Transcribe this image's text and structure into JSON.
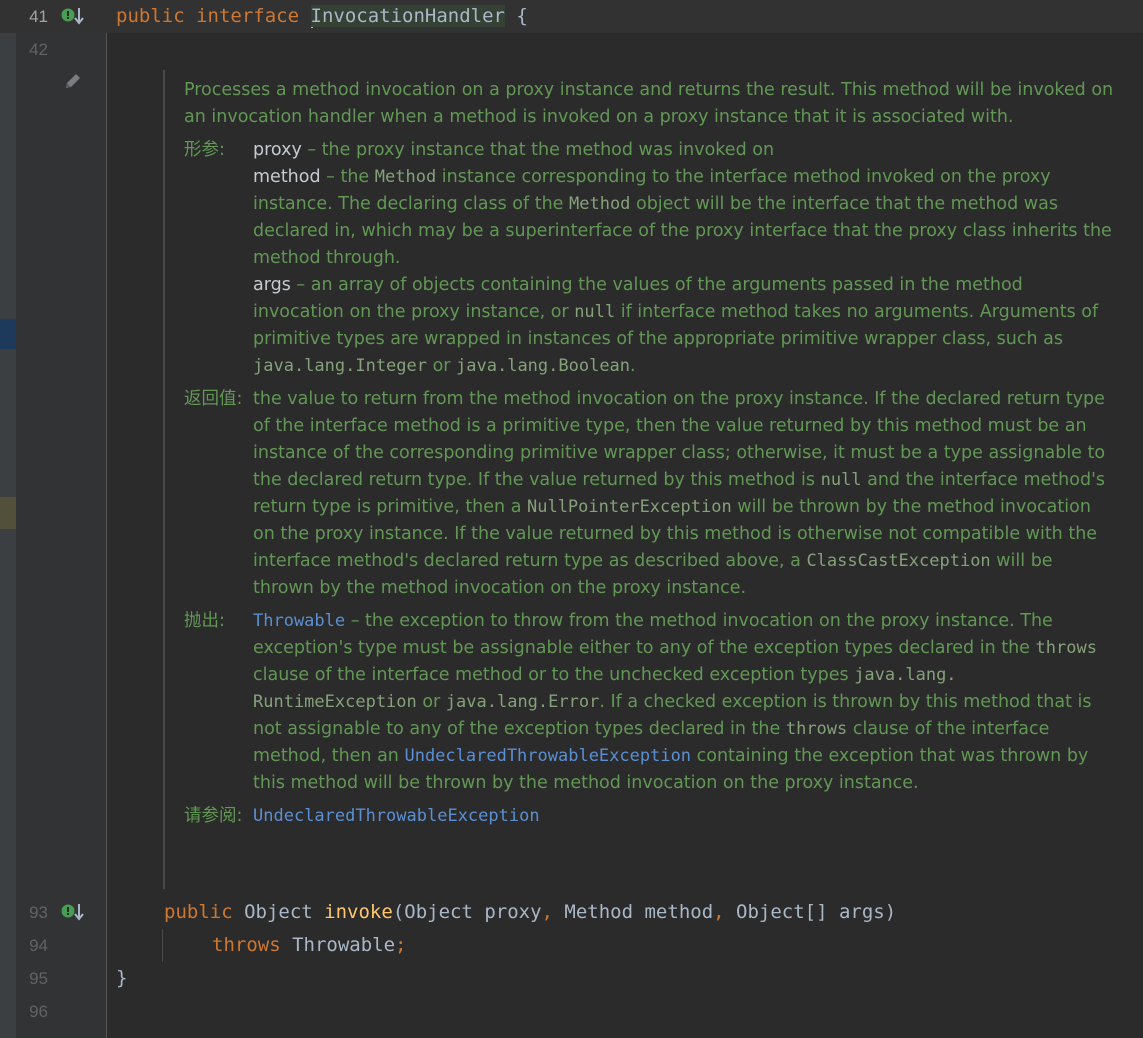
{
  "gutter": {
    "lines": [
      "41",
      "42",
      "93",
      "94",
      "95",
      "96"
    ]
  },
  "code": {
    "line41": {
      "kw1": "public",
      "kw2": "interface",
      "name": "InvocationHandler",
      "brace": "{"
    },
    "line93": {
      "kw": "public",
      "rest1": "Object ",
      "method": "invoke",
      "p1": "(Object proxy",
      "c1": ",",
      "p2": " Method method",
      "c2": ",",
      "p3": " Object[] args)"
    },
    "line94": {
      "kw": "throws",
      "type": " Throwable",
      "semi": ";"
    },
    "line95": {
      "brace": "}"
    }
  },
  "doc": {
    "description": "Processes a method invocation on a proxy instance and returns the result. This method will be invoked on an invocation handler when a method is invoked on a proxy instance that it is associated with.",
    "params_label": "形参:",
    "params": {
      "proxy_name": "proxy",
      "proxy_desc": " – the proxy instance that the method was invoked on",
      "method_name": "method",
      "method_desc1": " – the ",
      "method_code1": "Method",
      "method_desc2": " instance corresponding to the interface method invoked on the proxy instance. The declaring class of the ",
      "method_code2": "Method",
      "method_desc3": " object will be the interface that the method was declared in, which may be a superinterface of the proxy interface that the proxy class inherits the method through.",
      "args_name": "args",
      "args_desc1": " – an array of objects containing the values of the arguments passed in the method invocation on the proxy instance, or ",
      "args_code1": "null",
      "args_desc2": " if interface method takes no arguments. Arguments of primitive types are wrapped in instances of the appropriate primitive wrapper class, such as ",
      "args_code2": "java.lang.Integer",
      "args_desc3": " or ",
      "args_code3": "java.lang.Boolean",
      "args_desc4": "."
    },
    "returns_label": "返回值:",
    "returns": {
      "t1": "the value to return from the method invocation on the proxy instance. If the declared return type of the interface method is a primitive type, then the value returned by this method must be an instance of the corresponding primitive wrapper class; otherwise, it must be a type assignable to the declared return type. If the value returned by this method is ",
      "c1": "null",
      "t2": " and the interface method's return type is primitive, then a ",
      "c2": "NullPointerException",
      "t3": " will be thrown by the method invocation on the proxy instance. If the value returned by this method is otherwise not compatible with the interface method's declared return type as described above, a ",
      "c3": "ClassCastException",
      "t4": " will be thrown by the method invocation on the proxy instance."
    },
    "throws_label": "抛出:",
    "throws": {
      "link1": "Throwable",
      "t1": " – the exception to throw from the method invocation on the proxy instance. The exception's type must be assignable either to any of the exception types declared in the ",
      "c1": "throws",
      "t2": " clause of the interface method or to the unchecked exception types ",
      "c2": "java.lang. RuntimeException",
      "t3": " or ",
      "c3": "java.lang.Error",
      "t4": ". If a checked exception is thrown by this method that is not assignable to any of the exception types declared in the ",
      "c4": "throws",
      "t5": " clause of the interface method, then an ",
      "link2": "UndeclaredThrowableException",
      "t6": " containing the exception that was thrown by this method will be thrown by the method invocation on the proxy instance."
    },
    "see_label": "请参阅:",
    "see_link": "UndeclaredThrowableException"
  },
  "colors": {
    "background": "#2b2b2b",
    "gutter": "#313335",
    "keyword": "#cc7832",
    "method": "#ffc66d",
    "doc_text": "#629755",
    "link": "#5a8fd4",
    "implemented_icon": "#499c54"
  }
}
